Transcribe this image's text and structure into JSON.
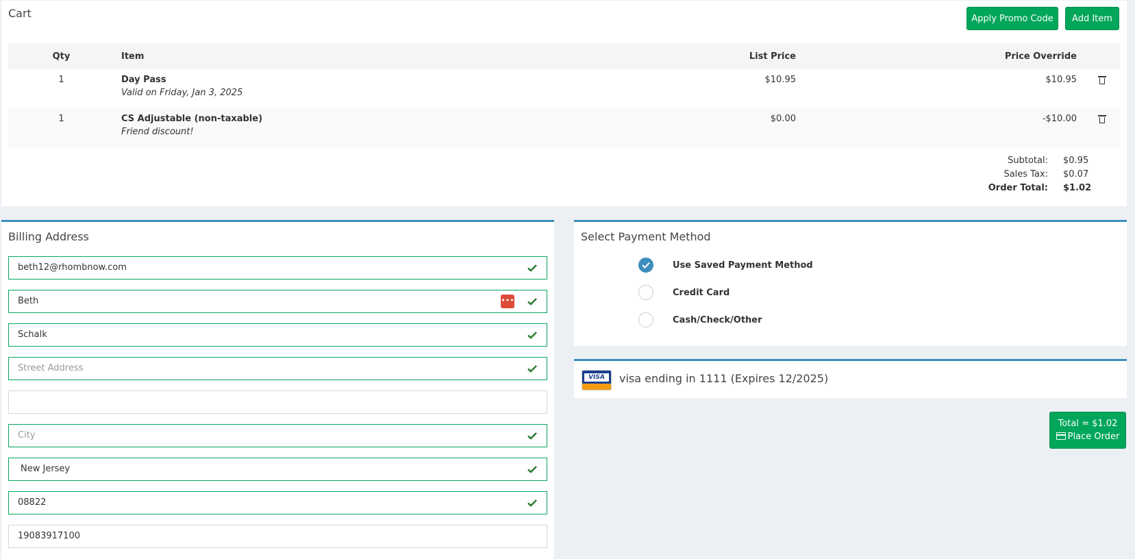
{
  "cart": {
    "title": "Cart",
    "apply_promo_label": "Apply Promo Code",
    "add_item_label": "Add Item",
    "columns": {
      "qty": "Qty",
      "item": "Item",
      "list_price": "List Price",
      "price_override": "Price Override"
    },
    "rows": [
      {
        "qty": "1",
        "name": "Day Pass",
        "note": "Valid on Friday, Jan 3, 2025",
        "list_price": "$10.95",
        "price_override": "$10.95"
      },
      {
        "qty": "1",
        "name": "CS Adjustable (non-taxable)",
        "note": "Friend discount!",
        "list_price": "$0.00",
        "price_override": "-$10.00"
      }
    ],
    "totals": {
      "subtotal_label": "Subtotal:",
      "subtotal": "$0.95",
      "tax_label": "Sales Tax:",
      "tax": "$0.07",
      "total_label": "Order Total:",
      "total": "$1.02"
    }
  },
  "billing": {
    "title": "Billing Address",
    "email_value": "beth12@rhombnow.com",
    "first_name_value": "Beth",
    "last_name_value": "Schalk",
    "street_placeholder": "Street Address",
    "street2_value": "",
    "city_placeholder": "City",
    "state_value": "New Jersey",
    "zip_value": "08822",
    "phone_value": "19083917100"
  },
  "payment": {
    "title": "Select Payment Method",
    "options": [
      {
        "label": "Use Saved Payment Method",
        "selected": true
      },
      {
        "label": "Credit Card",
        "selected": false
      },
      {
        "label": "Cash/Check/Other",
        "selected": false
      }
    ],
    "saved_card_text": "visa ending in 1111 (Expires 12/2025)",
    "card_brand": "VISA"
  },
  "order": {
    "total_line": "Total = $1.02",
    "place_order_label": "Place Order"
  },
  "colors": {
    "success": "#00a65a",
    "primary": "#3c8dbc",
    "danger": "#dd4b39"
  }
}
